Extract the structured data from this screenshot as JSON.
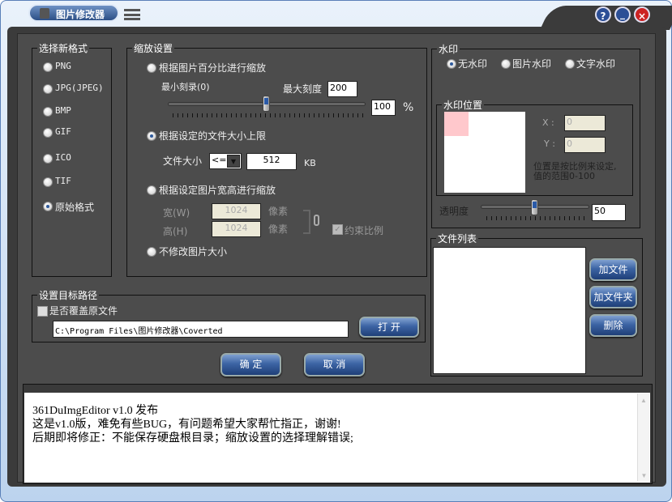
{
  "app": {
    "title": "图片修改器"
  },
  "titlebar": {
    "help": "?",
    "minimize": "_",
    "close": "×"
  },
  "colors": {
    "accent": "#2c4f86",
    "panel": "#4c4c4c",
    "pink": "#ffc8cc"
  },
  "format": {
    "legend": "选择新格式",
    "options": [
      "PNG",
      "JPG(JPEG)",
      "BMP",
      "GIF",
      "ICO",
      "TIF",
      "原始格式"
    ],
    "selected": "原始格式"
  },
  "scale": {
    "legend": "缩放设置",
    "by_percent": "根据图片百分比进行缩放",
    "min_label": "最小刻录(0)",
    "max_label": "最大刻度",
    "max_value": "200",
    "percent_value": "100",
    "percent_unit": "%",
    "slider_value_percent": 50,
    "by_filesize": "根据设定的文件大小上限",
    "filesize_label": "文件大小",
    "operator": "<=",
    "filesize_value": "512",
    "filesize_unit": "KB",
    "by_dimensions": "根据设定图片宽高进行缩放",
    "width_label": "宽(W)",
    "width_value": "1024",
    "height_label": "高(H)",
    "height_value": "1024",
    "pixel_unit": "像素",
    "keep_ratio": "约束比例",
    "no_resize": "不修改图片大小",
    "selected": "根据设定的文件大小上限"
  },
  "watermark": {
    "legend": "水印",
    "options": [
      "无水印",
      "图片水印",
      "文字水印"
    ],
    "selected": "无水印",
    "position_legend": "水印位置",
    "x_label": "X :",
    "x_value": "0",
    "y_label": "Y :",
    "y_value": "0",
    "hint": [
      "位置是按比例来设定,",
      "值的范围0-100"
    ],
    "opacity_label": "透明度",
    "opacity_value": "50"
  },
  "files": {
    "legend": "文件列表",
    "add_file": "加文件",
    "add_folder": "加文件夹",
    "delete": "删除"
  },
  "target": {
    "legend": "设置目标路径",
    "overwrite": "是否覆盖原文件",
    "path": "C:\\Program Files\\图片修改器\\Coverted",
    "open": "打  开"
  },
  "actions": {
    "ok": "确  定",
    "cancel": "取  消"
  },
  "log": {
    "lines": [
      "361DuImgEditor v1.0 发布",
      "这是v1.0版，难免有些BUG，有问题希望大家帮忙指正，谢谢!",
      "后期即将修正：不能保存硬盘根目录；缩放设置的选择理解错误;"
    ]
  }
}
